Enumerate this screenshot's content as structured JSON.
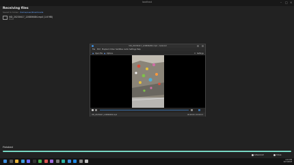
{
  "window": {
    "title": "localhost"
  },
  "receiving": {
    "title": "Receiving files",
    "subtitle_prefix": "Saved to folder: ",
    "folder_link": "/home/user/Downloads",
    "file": {
      "name": "VID_20230417_120806484.mp4 (1.6 MB)",
      "size": "Done"
    }
  },
  "player": {
    "title": "VID_20230417_120806484.mp4 - Celluloid",
    "menu": [
      "File",
      "Edit",
      "Playback",
      "Video",
      "Subtitles",
      "Audio",
      "Settings",
      "Help"
    ],
    "tools": {
      "open_file": "Open File",
      "options": "Options",
      "settings": "Settings"
    },
    "status_left": "VID_20230417_120806484.mp4",
    "status_right": "00:00:00 / 00:00:13",
    "progress_fraction": 0.02
  },
  "finished": {
    "label": "Finished",
    "progress_fraction": 1.0
  },
  "tray": {
    "advanced_label": "Advanced",
    "close_label": "Close"
  },
  "clock": {
    "time": "4:23 PM",
    "date": "4/17/2023"
  },
  "colors": {
    "accent": "#78d8c4",
    "link": "#6aa6ff",
    "player_bar": "#3a6ea5"
  },
  "taskbar_icons": [
    "windows-icon",
    "search-icon",
    "files-icon",
    "browser-icon",
    "store-icon",
    "terminal-icon",
    "photos-icon",
    "editor-icon",
    "music-icon",
    "settings-icon",
    "chat-icon",
    "mail-icon",
    "code-icon",
    "tools-icon",
    "game-icon"
  ]
}
